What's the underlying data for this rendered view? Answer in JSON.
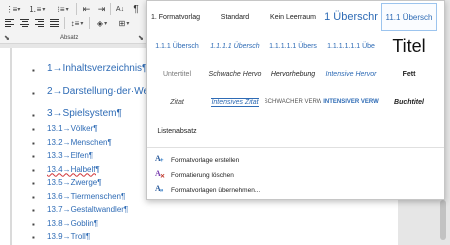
{
  "ribbon": {
    "group_label": "Absatz",
    "sort_symbol": "A↓",
    "pilcrow_symbol": "¶",
    "dropdown_glyph": "▾",
    "launcher_glyph": "⬊"
  },
  "document": {
    "headings": [
      "1→Inhaltsverzeichnis¶",
      "2→Darstellung·der·We",
      "3→Spielsystem¶"
    ],
    "bullet_glyph": "▪",
    "list_items": [
      "13.1→Völker¶",
      "13.2→Menschen¶",
      "13.3→Elfen¶",
      "13.4→Halbelf¶",
      "13.5→Zwerge¶",
      "13.6→Tiermenschen¶",
      "13.7→Gestaltwandler¶",
      "13.8→Goblin¶",
      "13.9→Troll¶"
    ]
  },
  "styles_gallery": {
    "rows": [
      [
        "1. Formatvorlag",
        "Standard",
        "Kein Leerraum",
        "1 Überschr",
        "11.1 Übersch"
      ],
      [
        "1.1.1 Übersch",
        "1.1.1.1 Übersch",
        "1.1.1.1.1 Übers",
        "1.1.1.1.1.1 Übe",
        "Titel"
      ],
      [
        "Untertitel",
        "Schwache Hervo",
        "Hervorhebung",
        "Intensive Hervor",
        "Fett"
      ],
      [
        "Zitat",
        "Intensives Zitat",
        "Schwacher Verw",
        "Intensiver Verw",
        "Buchtitel"
      ],
      [
        "Listenabsatz"
      ]
    ],
    "selected_index": [
      0,
      4
    ],
    "commands": [
      {
        "label": "Formatvorlage erstellen",
        "icon": "create-style-icon",
        "glyph": "+"
      },
      {
        "label": "Formatierung löschen",
        "icon": "clear-formatting-icon",
        "glyph": "✕"
      },
      {
        "label": "Formatvorlagen übernehmen...",
        "icon": "apply-styles-icon",
        "glyph": "»"
      }
    ]
  },
  "colors": {
    "heading_blue": "#2e6bb5",
    "accent_blue": "#1f5fa8",
    "selected_border": "#9cc4ee"
  }
}
